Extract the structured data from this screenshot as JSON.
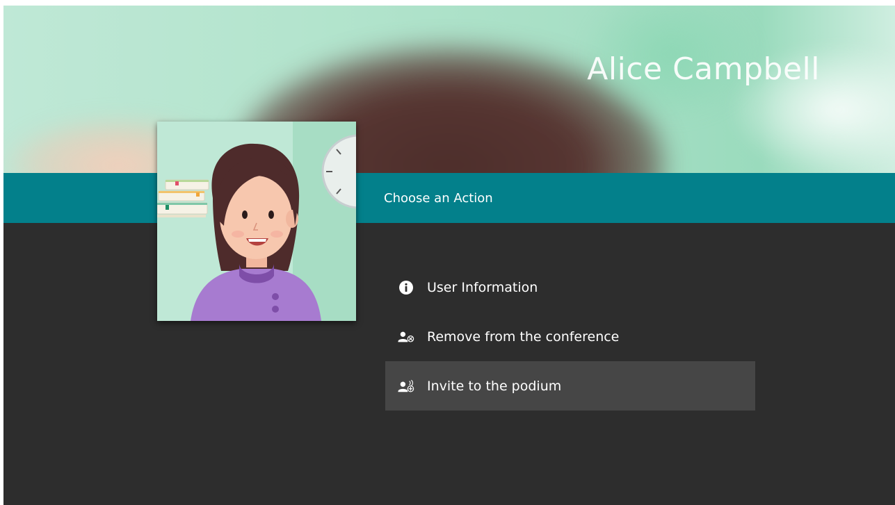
{
  "profile": {
    "name": "Alice Campbell"
  },
  "action_bar": {
    "title": "Choose an Action"
  },
  "actions": [
    {
      "label": "User Information",
      "icon": "info-icon",
      "selected": false
    },
    {
      "label": "Remove from the conference",
      "icon": "remove-user-icon",
      "selected": false
    },
    {
      "label": "Invite to the podium",
      "icon": "invite-podium-icon",
      "selected": true
    }
  ],
  "colors": {
    "action_bar": "#03808b",
    "background": "#2d2d2d",
    "selected_item": "#464646"
  }
}
